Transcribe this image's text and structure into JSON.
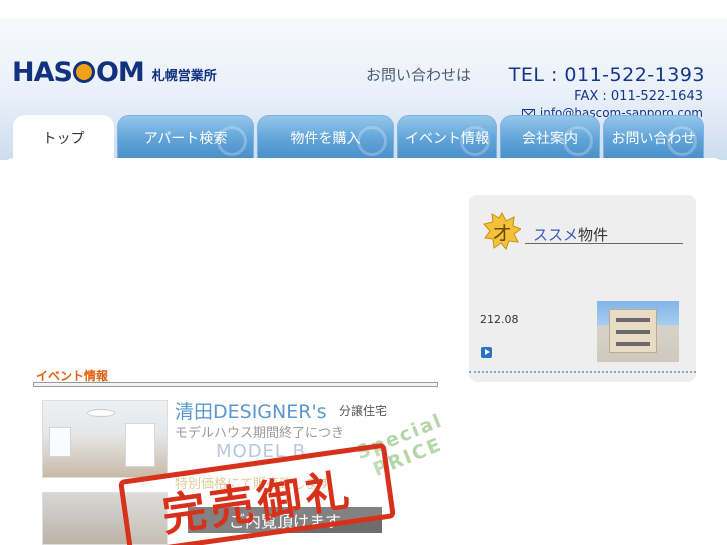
{
  "header": {
    "logo_text_left": "HA",
    "logo_text_right": "OM",
    "branch": "札幌営業所",
    "contact_lead": "お問い合わせは",
    "tel": "TEL : 011-522-1393",
    "fax": "FAX : 011-522-1643",
    "email": "info@hascom-sapporo.com"
  },
  "tabs": [
    {
      "label": "トップ",
      "active": true
    },
    {
      "label": "アパート検索",
      "active": false
    },
    {
      "label": "物件を購入",
      "active": false
    },
    {
      "label": "イベント情報",
      "active": false
    },
    {
      "label": "会社案内",
      "active": false
    },
    {
      "label": "お問い合わせ",
      "active": false
    }
  ],
  "event": {
    "section_title": "イベント情報",
    "banner": {
      "title": "清田DESIGNER's",
      "subtitle": "分譲住宅",
      "line1": "モデルハウス期間終了につき",
      "model": "MODEL B",
      "special": "Special PRICE",
      "line2": "特別価格にて販売致します",
      "button": "ご内覧頂けます",
      "stamp": "完売御礼"
    }
  },
  "recommend": {
    "badge": "オ",
    "title_accent": "ススメ",
    "title_tail": "物件",
    "date": "212.08"
  },
  "colors": {
    "brand_navy": "#12317f",
    "brand_orange": "#f0a318",
    "tab_blue": "#5fa3d8",
    "event_orange": "#e0600f",
    "stamp_red": "#d7311c"
  }
}
